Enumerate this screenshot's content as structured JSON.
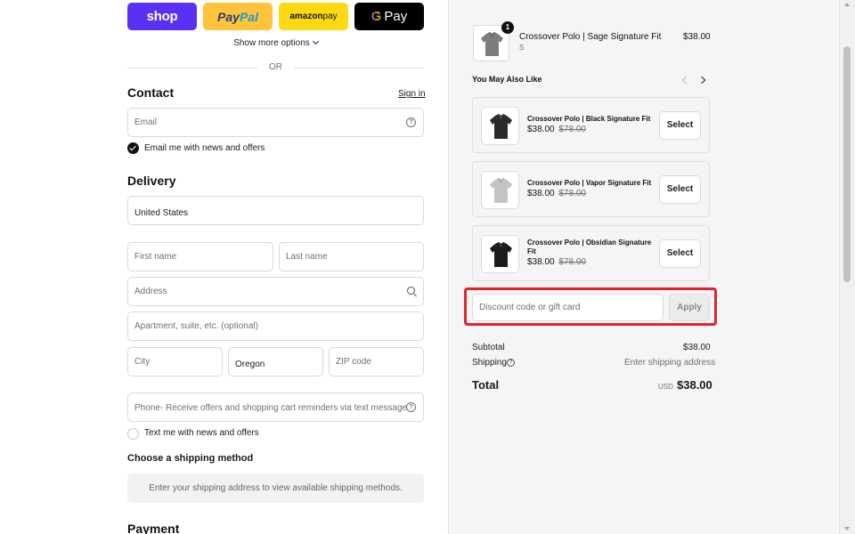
{
  "express_pay": {
    "shop_label": "shop",
    "paypal_label_1": "Pay",
    "paypal_label_2": "Pal",
    "amazon_label_1": "amazon",
    "amazon_label_2": " pay",
    "gpay_g": "G",
    "gpay_label": "Pay",
    "show_more": "Show more options",
    "divider": "OR"
  },
  "contact": {
    "heading": "Contact",
    "sign_in": "Sign in",
    "email_placeholder": "Email",
    "newsletter_label": "Email me with news and offers",
    "newsletter_checked": true
  },
  "delivery": {
    "heading": "Delivery",
    "country": "United States",
    "first_name_placeholder": "First name",
    "last_name_placeholder": "Last name",
    "address_placeholder": "Address",
    "apartment_placeholder": "Apartment, suite, etc. (optional)",
    "city_placeholder": "City",
    "state": "Oregon",
    "zip_placeholder": "ZIP code",
    "phone_placeholder": "Phone- Receive offers and shopping cart reminders via text message",
    "sms_label": "Text me with news and offers",
    "sms_checked": false
  },
  "shipping": {
    "heading": "Choose a shipping method",
    "message": "Enter your shipping address to view available shipping methods."
  },
  "payment": {
    "heading": "Payment"
  },
  "cart": {
    "item": {
      "name": "Crossover Polo | Sage Signature Fit",
      "variant": "S",
      "price": "$38.00",
      "quantity": "1",
      "color": "#7d7d7d"
    },
    "upsell_heading": "You May Also Like",
    "suggestions": [
      {
        "name": "Crossover Polo | Black Signature Fit",
        "price": "$38.00",
        "compare_price": "$78.00",
        "button": "Select",
        "color": "#2b2b2b"
      },
      {
        "name": "Crossover Polo | Vapor Signature Fit",
        "price": "$38.00",
        "compare_price": "$78.00",
        "button": "Select",
        "color": "#c4c4c4"
      },
      {
        "name": "Crossover Polo | Obsidian Signature Fit",
        "price": "$38.00",
        "compare_price": "$78.00",
        "button": "Select",
        "color": "#1c1c1c"
      }
    ],
    "discount_placeholder": "Discount code or gift card",
    "apply_label": "Apply",
    "subtotal_label": "Subtotal",
    "subtotal_value": "$38.00",
    "shipping_label": "Shipping",
    "shipping_value": "Enter shipping address",
    "total_label": "Total",
    "currency": "USD",
    "total_value": "$38.00"
  },
  "colors": {
    "highlight": "#e3232c",
    "shop_pay": "#5a31f4",
    "paypal": "#ffc439",
    "amazon_pay": "#ffd814"
  }
}
